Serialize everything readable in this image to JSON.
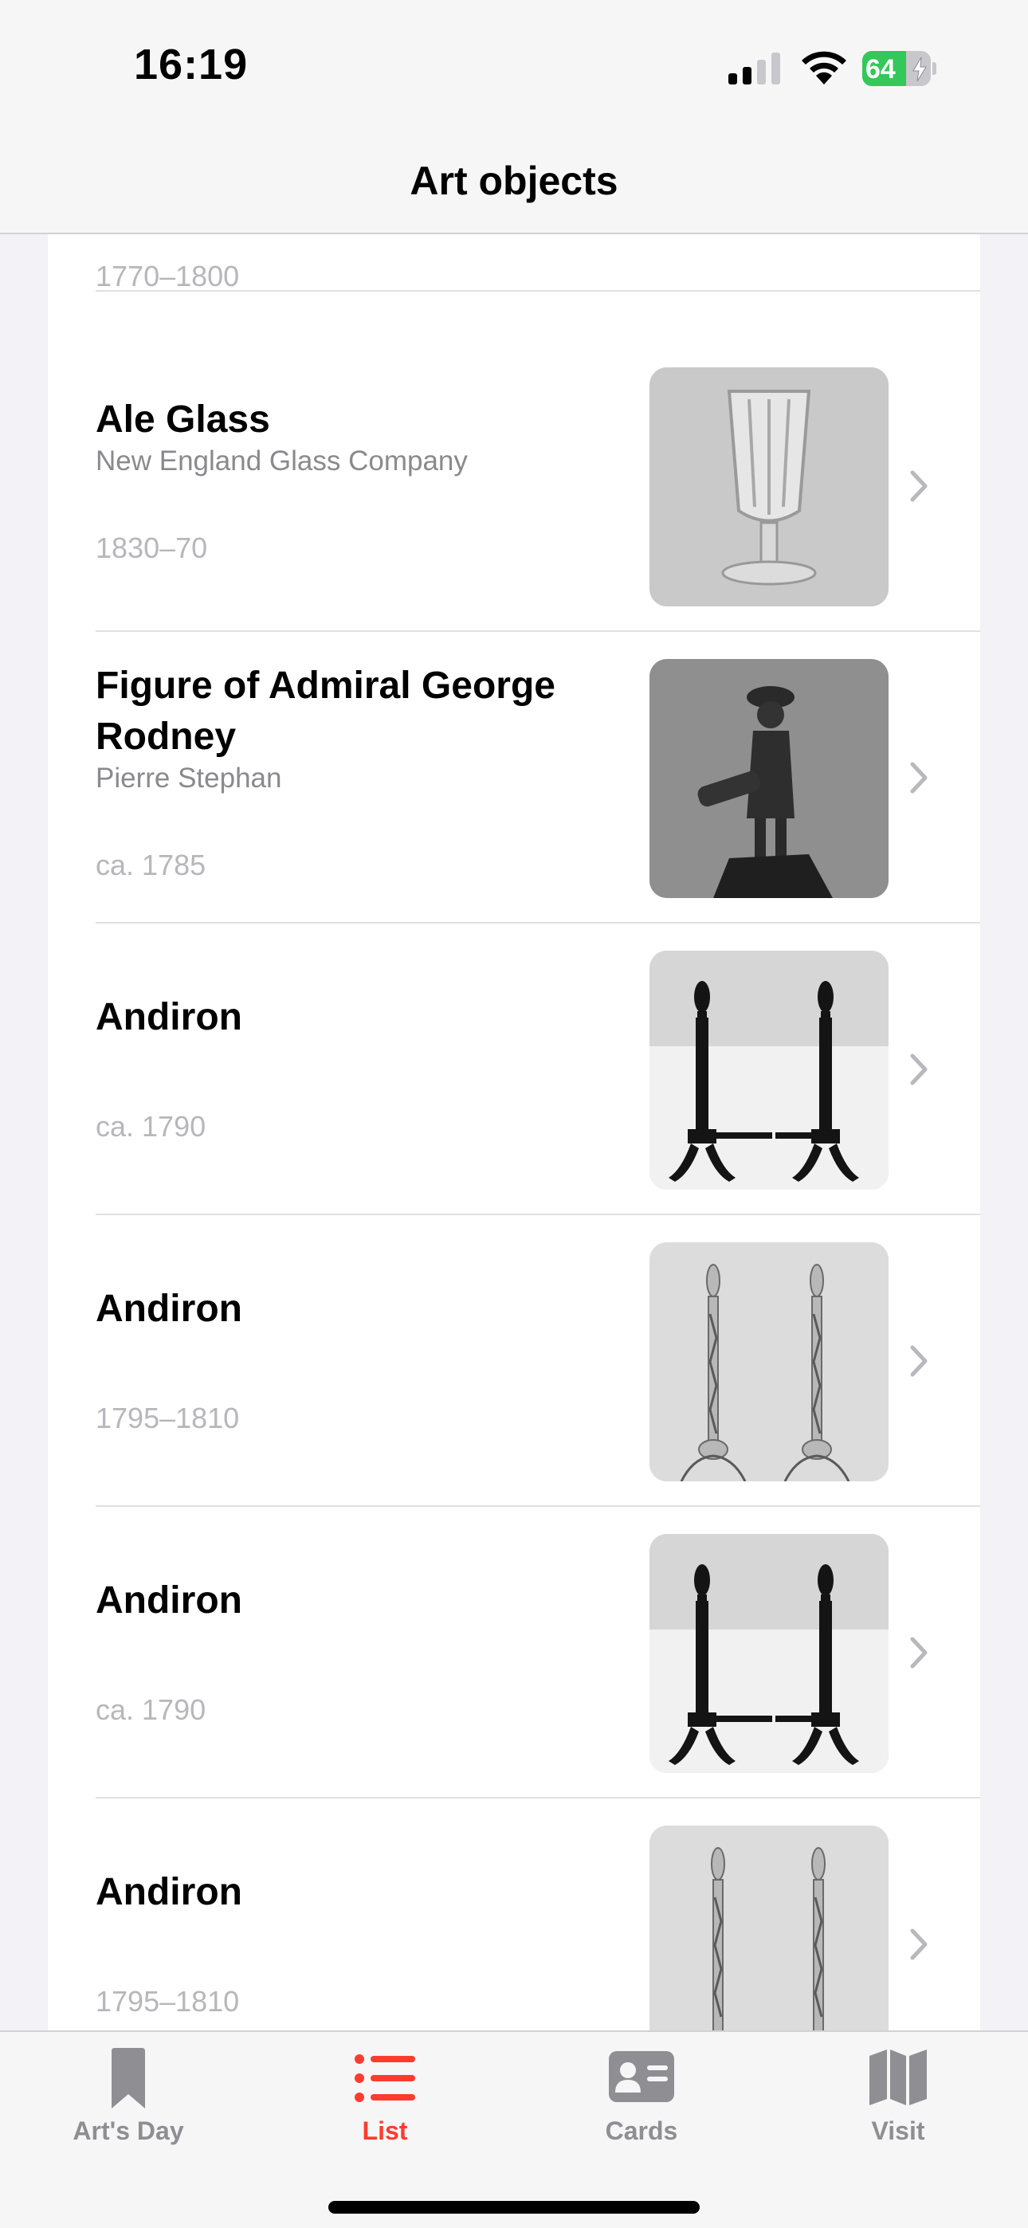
{
  "status_bar": {
    "time": "16:19",
    "battery_level": "64",
    "battery_percent": 64,
    "charging": true
  },
  "nav": {
    "title": "Art objects"
  },
  "list": {
    "items": [
      {
        "title": "",
        "artist": "",
        "date": "1770–1800",
        "thumbnail": "framed-document-photo"
      },
      {
        "title": "Ale Glass",
        "artist": "New England Glass Company",
        "date": "1830–70",
        "thumbnail": "ale-glass-photo"
      },
      {
        "title": "Figure of Admiral George Rodney",
        "artist": "Pierre Stephan",
        "date": "ca. 1785",
        "thumbnail": "admiral-figure-photo"
      },
      {
        "title": "Andiron",
        "artist": "",
        "date": "ca. 1790",
        "thumbnail": "andirons-dark-photo"
      },
      {
        "title": "Andiron",
        "artist": "",
        "date": "1795–1810",
        "thumbnail": "andirons-brass-photo"
      },
      {
        "title": "Andiron",
        "artist": "",
        "date": "ca. 1790",
        "thumbnail": "andirons-dark-photo"
      },
      {
        "title": "Andiron",
        "artist": "",
        "date": "1795–1810",
        "thumbnail": "andirons-brass-photo"
      }
    ]
  },
  "tab_bar": {
    "tabs": [
      {
        "label": "Art's Day",
        "icon": "bookmark-icon",
        "active": false
      },
      {
        "label": "List",
        "icon": "list-icon",
        "active": true
      },
      {
        "label": "Cards",
        "icon": "contact-card-icon",
        "active": false
      },
      {
        "label": "Visit",
        "icon": "map-icon",
        "active": false
      }
    ]
  },
  "colors": {
    "accent": "#ff3b30",
    "inactive": "#8e8e93",
    "battery": "#34c759"
  }
}
